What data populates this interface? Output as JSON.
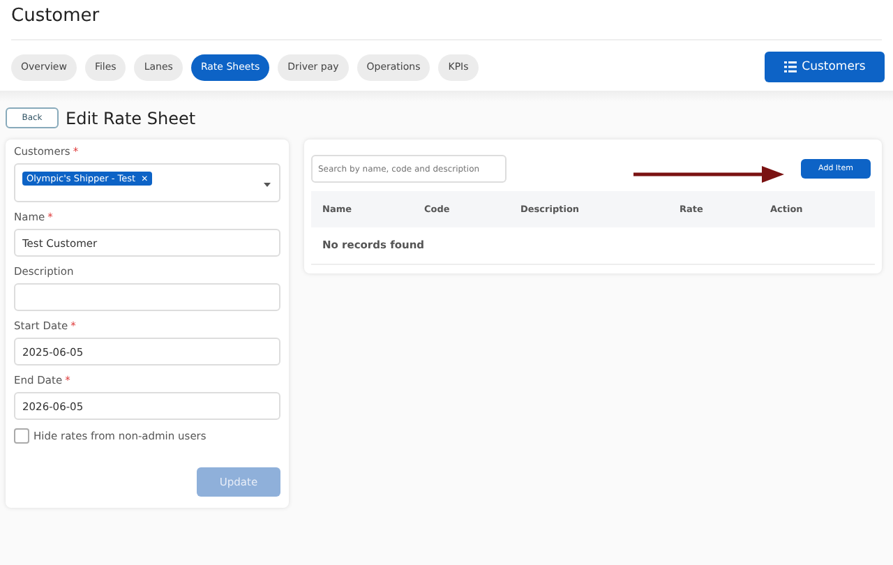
{
  "page_title": "Customer",
  "tabs": [
    {
      "label": "Overview",
      "selected": false
    },
    {
      "label": "Files",
      "selected": false
    },
    {
      "label": "Lanes",
      "selected": false
    },
    {
      "label": "Rate Sheets",
      "selected": true
    },
    {
      "label": "Driver pay",
      "selected": false
    },
    {
      "label": "Operations",
      "selected": false
    },
    {
      "label": "KPIs",
      "selected": false
    }
  ],
  "customers_button": "Customers",
  "back_button": "Back",
  "form_title": "Edit Rate Sheet",
  "fields": [
    {
      "kind": "multiselect",
      "label": "Customers",
      "required_mark": "*",
      "tags": [
        {
          "label": "Olympic's Shipper - Test",
          "remove": "✕"
        }
      ]
    },
    {
      "kind": "text",
      "label": "Name",
      "required_mark": "*",
      "value": "Test Customer"
    },
    {
      "kind": "text",
      "label": "Description"
    },
    {
      "kind": "text",
      "label": "Start Date",
      "required_mark": "*",
      "value": "2025-06-05"
    },
    {
      "kind": "text",
      "label": "End Date",
      "required_mark": "*",
      "value": "2026-06-05"
    }
  ],
  "hide_rates": {
    "label": "Hide rates from non-admin users",
    "checked": false
  },
  "update_button": {
    "label": "Update",
    "disabled": true
  },
  "search": {
    "placeholder": "Search by name, code and description"
  },
  "add_button": "Add Item",
  "table": {
    "columns": [
      "Name",
      "Code",
      "Description",
      "Rate",
      "Action"
    ],
    "empty": "No records found"
  }
}
